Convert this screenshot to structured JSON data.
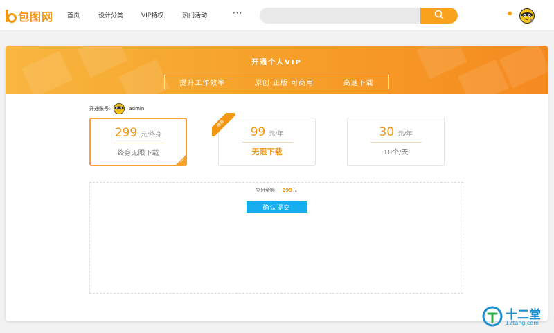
{
  "header": {
    "logo_text": "包图网",
    "nav": [
      "首页",
      "设计分类",
      "VIP特权",
      "热门活动"
    ],
    "more": "···",
    "search": {
      "placeholder": ""
    }
  },
  "banner": {
    "title": "开通个人VIP",
    "features": [
      "提升工作效率",
      "原创·正版·可商用",
      "高速下载"
    ]
  },
  "account": {
    "label": "开通账号:",
    "username": "admin"
  },
  "plans": [
    {
      "price": "299",
      "unit": "元/终身",
      "desc": "终身无限下载",
      "selected": true
    },
    {
      "price": "99",
      "unit": "元/年",
      "desc": "无限下载",
      "badge": "推荐",
      "selected": false
    },
    {
      "price": "30",
      "unit": "元/年",
      "desc": "10个/天",
      "selected": false
    }
  ],
  "payment": {
    "label": "应付金额:",
    "amount": "299",
    "currency": "元",
    "confirm_label": "确认提交"
  },
  "watermark": {
    "text": "十二堂",
    "url": "12tang.com"
  },
  "colors": {
    "accent": "#f39712",
    "button_blue": "#17aef0",
    "banner_start": "#f8b640",
    "banner_end": "#f58a20"
  }
}
